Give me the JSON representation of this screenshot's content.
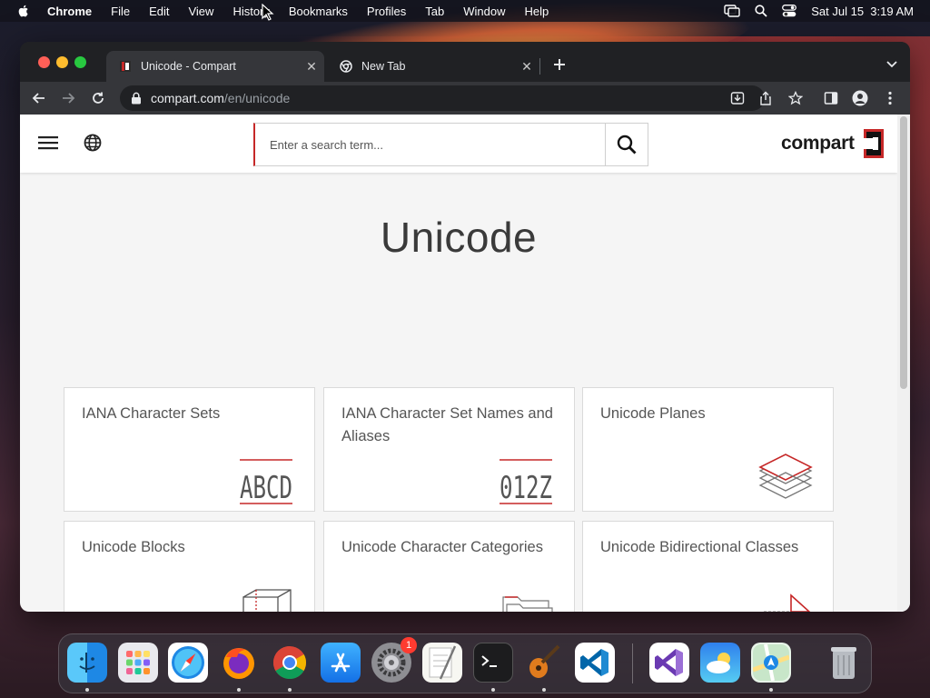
{
  "menubar": {
    "app_name": "Chrome",
    "items": [
      "File",
      "Edit",
      "View",
      "History",
      "Bookmarks",
      "Profiles",
      "Tab",
      "Window",
      "Help"
    ],
    "clock": "Sat Jul 15  3:19 AM"
  },
  "browser": {
    "tabs": [
      {
        "title": "Unicode - Compart",
        "close": "✕",
        "active": true
      },
      {
        "title": "New Tab",
        "close": "✕",
        "active": false
      }
    ],
    "url_host": "compart.com",
    "url_path": "/en/unicode"
  },
  "site": {
    "search_placeholder": "Enter a search term...",
    "logo_text": "compart",
    "page_title": "Unicode",
    "cards": [
      {
        "label": "IANA Character Sets",
        "icon": "abcd-letters-icon",
        "art_text": "ABCD"
      },
      {
        "label": "IANA Character Set Names and Aliases",
        "icon": "o12z-letters-icon",
        "art_text": "012Z"
      },
      {
        "label": "Unicode Planes",
        "icon": "stacked-planes-icon"
      },
      {
        "label": "Unicode Blocks",
        "icon": "cube-icon"
      },
      {
        "label": "Unicode Character Categories",
        "icon": "folders-icon"
      },
      {
        "label": "Unicode Bidirectional Classes",
        "icon": "bidi-arrows-icon"
      }
    ]
  },
  "dock": {
    "apps": [
      "Finder",
      "Launchpad",
      "Safari",
      "Firefox",
      "Google Chrome",
      "App Store",
      "System Settings",
      "TextEdit",
      "Terminal",
      "GarageBand",
      "Visual Studio Code",
      "Visual Studio",
      "Weather",
      "Maps",
      "Trash"
    ],
    "settings_badge": "1"
  },
  "colors": {
    "accent_red": "#c62828",
    "page_bg": "#f5f5f5",
    "chrome_dark": "#202124",
    "chrome_toolbar": "#35363a"
  }
}
